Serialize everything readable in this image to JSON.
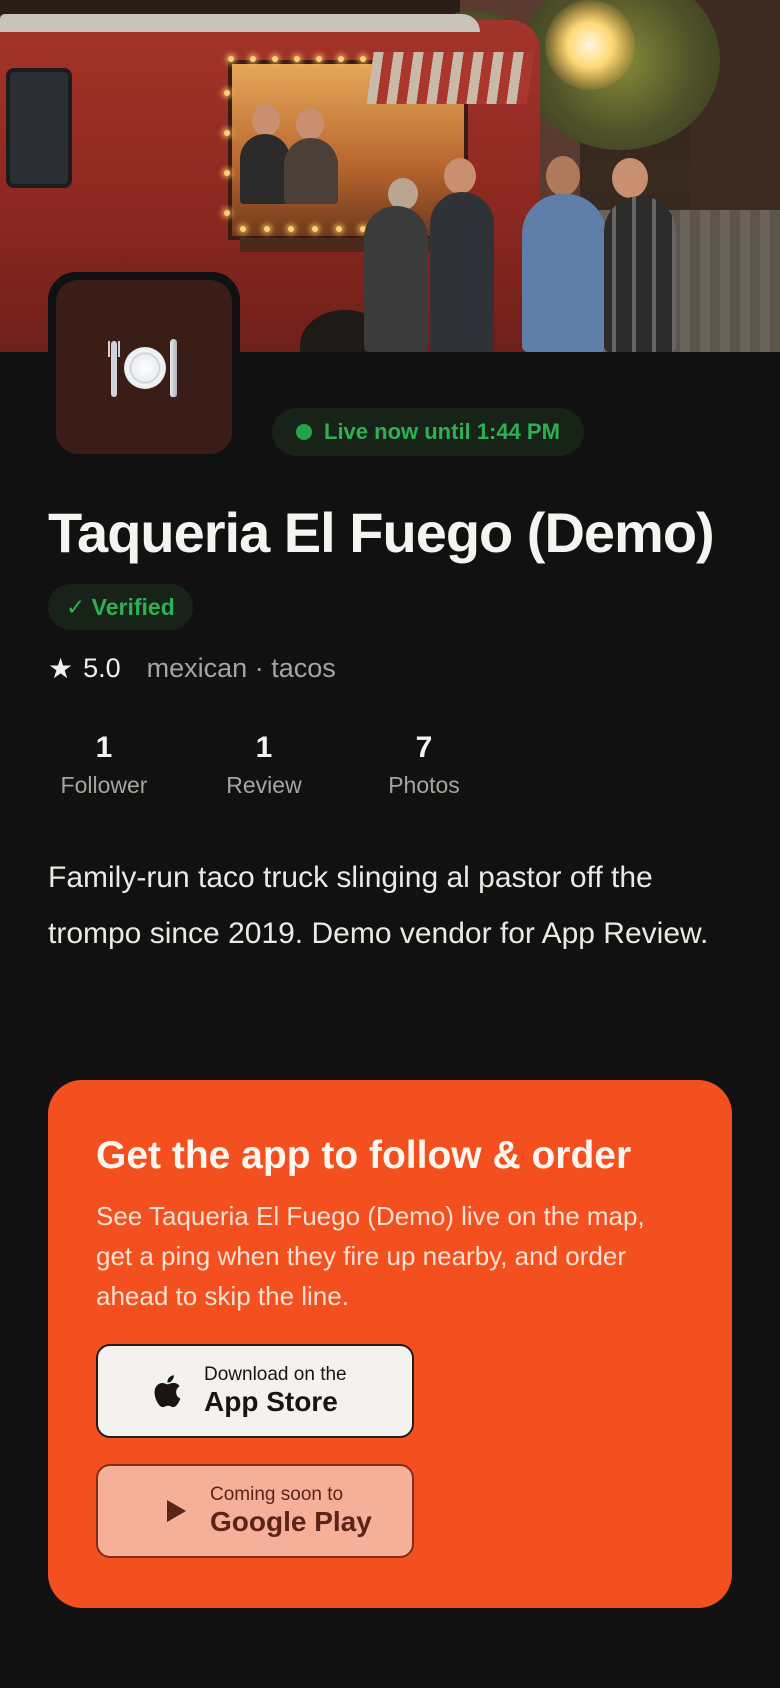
{
  "hero": {
    "image_alt": "Taco truck street scene at sunset"
  },
  "vendor": {
    "name": "Taqueria El Fuego (Demo)",
    "avatar_icon": "plate-with-cutlery-icon",
    "live_status": "Live now until 1:44 PM",
    "verified_label": "✓ Verified",
    "rating": "5.0",
    "rating_icon": "star-icon",
    "cuisine": "mexican · tacos",
    "bio": "Family-run taco truck slinging al pastor off the trompo since 2019. Demo vendor for App Review."
  },
  "stats": [
    {
      "value": "1",
      "label": "Follower"
    },
    {
      "value": "1",
      "label": "Review"
    },
    {
      "value": "7",
      "label": "Photos"
    }
  ],
  "cta": {
    "title": "Get the app to follow & order",
    "description": "See Taqueria El Fuego (Demo) live on the map, get a ping when they fire up nearby, and order ahead to skip the line.",
    "app_store": {
      "small": "Download on the",
      "big": "App Store",
      "icon": "apple-icon"
    },
    "google_play": {
      "small": "Coming soon to",
      "big": "Google Play",
      "icon": "play-icon"
    }
  },
  "colors": {
    "background": "#121111",
    "accent": "#f44f1f",
    "live_green": "#2fb052",
    "muted_text": "#a7a39d"
  }
}
